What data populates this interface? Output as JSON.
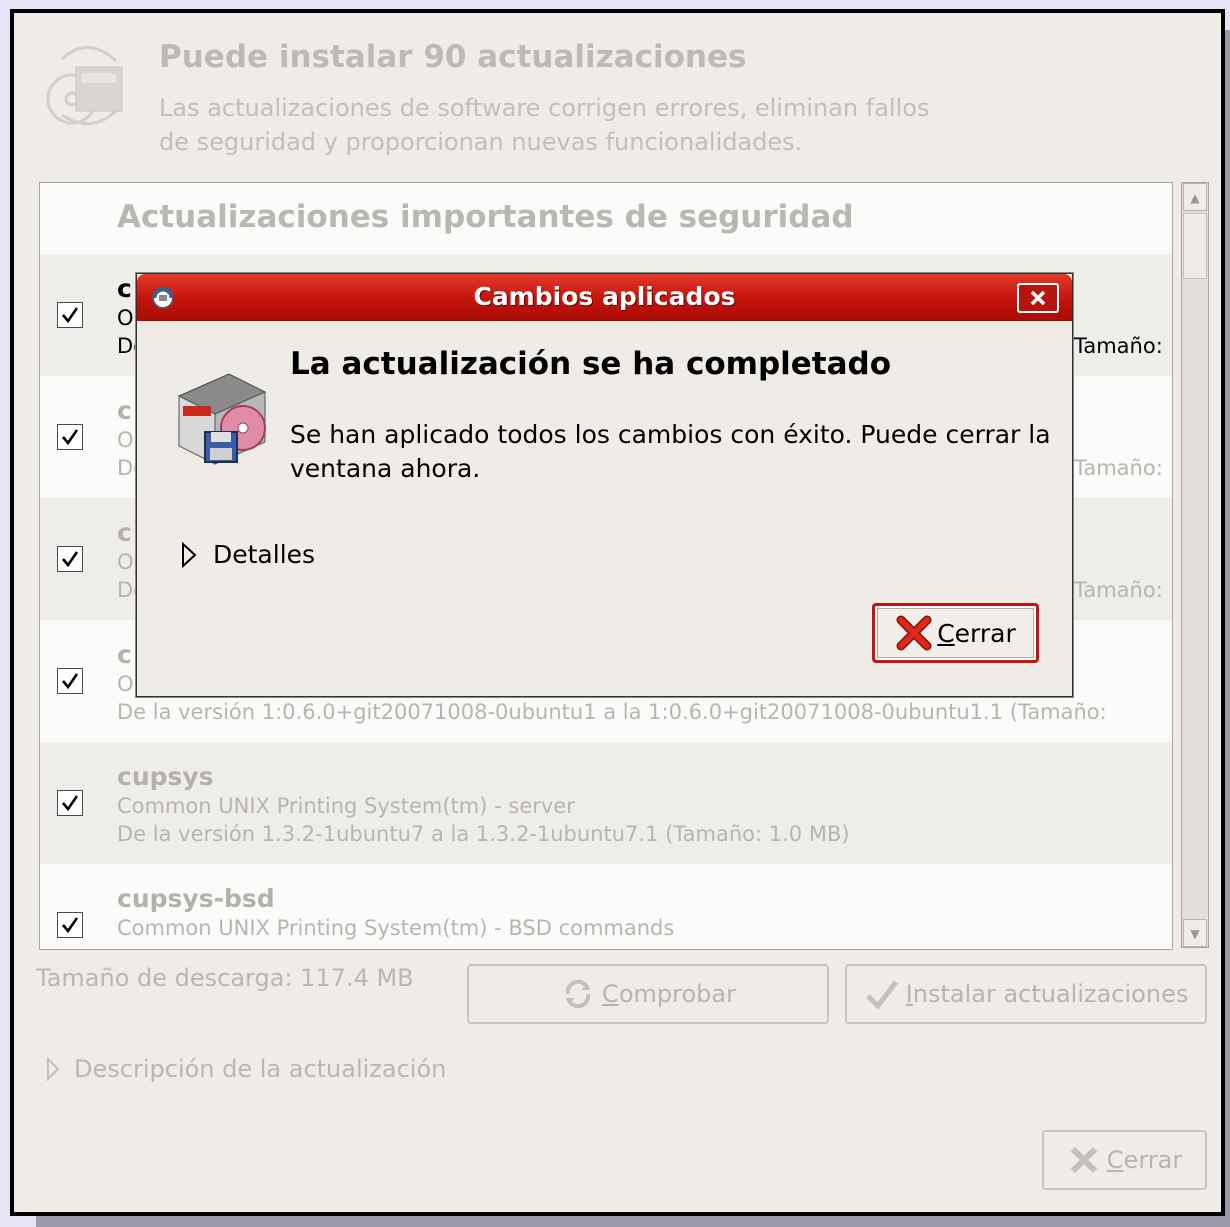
{
  "header": {
    "title": "Puede instalar 90 actualizaciones",
    "subtitle": "Las actualizaciones de software corrigen errores, eliminan fallos de seguridad y proporcionan nuevas funcionalidades."
  },
  "list": {
    "section_heading": "Actualizaciones importantes de seguridad",
    "rows": [
      {
        "name_fragment": "c",
        "desc_fragment": "O",
        "ver_fragment": "De",
        "size_label": "Tamaño:",
        "checked": true
      },
      {
        "name_fragment": "c",
        "desc_fragment": "O",
        "ver_fragment": "De",
        "size_label": "Tamaño:",
        "checked": true
      },
      {
        "name_fragment": "c",
        "desc_fragment": "O",
        "ver_fragment": "De",
        "size_label": "Tamaño:",
        "checked": true
      },
      {
        "name_fragment": "c",
        "desc_fragment": "O",
        "version": "De la versión 1:0.6.0+git20071008-0ubuntu1 a la 1:0.6.0+git20071008-0ubuntu1.1 (Tamaño:",
        "checked": true
      },
      {
        "name": "cupsys",
        "desc": "Common UNIX Printing System(tm) - server",
        "version": "De la versión 1.3.2-1ubuntu7 a la 1.3.2-1ubuntu7.1 (Tamaño: 1.0 MB)",
        "checked": true
      },
      {
        "name": "cupsys-bsd",
        "desc": "Common UNIX Printing System(tm) - BSD commands",
        "checked": true
      }
    ]
  },
  "footer": {
    "download_size": "Tamaño de descarga: 117.4 MB",
    "check_button": {
      "mnemonic": "C",
      "rest": "omprobar"
    },
    "install_button": {
      "mnemonic": "I",
      "rest": "nstalar actualizaciones"
    },
    "description_expander": "Descripción de la actualización",
    "close_button": {
      "mnemonic": "C",
      "rest": "errar"
    }
  },
  "dialog": {
    "title": "Cambios aplicados",
    "heading": "La actualización se ha completado",
    "message": "Se han aplicado todos los cambios con éxito. Puede cerrar la ventana ahora.",
    "details_label": "Detalles",
    "close_button": {
      "mnemonic": "C",
      "rest": "errar"
    }
  },
  "colors": {
    "titlebar": "#c4130b",
    "window_bg": "#efebe7",
    "dimmed_text": "#b8b5b0"
  }
}
